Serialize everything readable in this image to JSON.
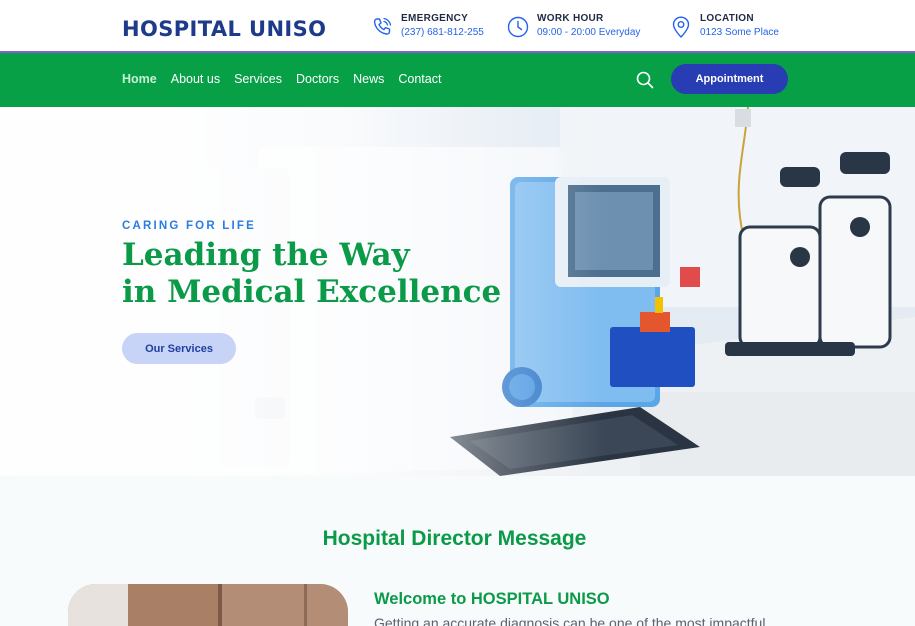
{
  "brand": {
    "name": "HOSPITAL UNISO"
  },
  "contact_info": [
    {
      "icon": "phone-icon",
      "label": "EMERGENCY",
      "value": "(237) 681-812-255"
    },
    {
      "icon": "clock-icon",
      "label": "WORK HOUR",
      "value": "09:00 - 20:00 Everyday"
    },
    {
      "icon": "location-pin-icon",
      "label": "LOCATION",
      "value": "0123 Some Place"
    }
  ],
  "nav": {
    "items": [
      {
        "label": "Home",
        "active": true
      },
      {
        "label": "About us",
        "active": false
      },
      {
        "label": "Services",
        "active": false
      },
      {
        "label": "Doctors",
        "active": false
      },
      {
        "label": "News",
        "active": false
      },
      {
        "label": "Contact",
        "active": false
      }
    ],
    "appointment_label": "Appointment"
  },
  "hero": {
    "eyebrow": "CARING FOR LIFE",
    "headline_line1": "Leading the Way",
    "headline_line2": "in Medical Excellence",
    "cta_label": "Our Services"
  },
  "director": {
    "section_title": "Hospital Director Message",
    "welcome": "Welcome to HOSPITAL UNISO",
    "intro": "Getting an accurate diagnosis can be one of the most impactful"
  },
  "colors": {
    "brand_navy": "#1e3a8a",
    "nav_green": "#07a047",
    "heading_green": "#0a9a48",
    "accent_blue": "#2563eb",
    "appointment_button": "#283cb4",
    "services_button": "#c7d3f7"
  }
}
